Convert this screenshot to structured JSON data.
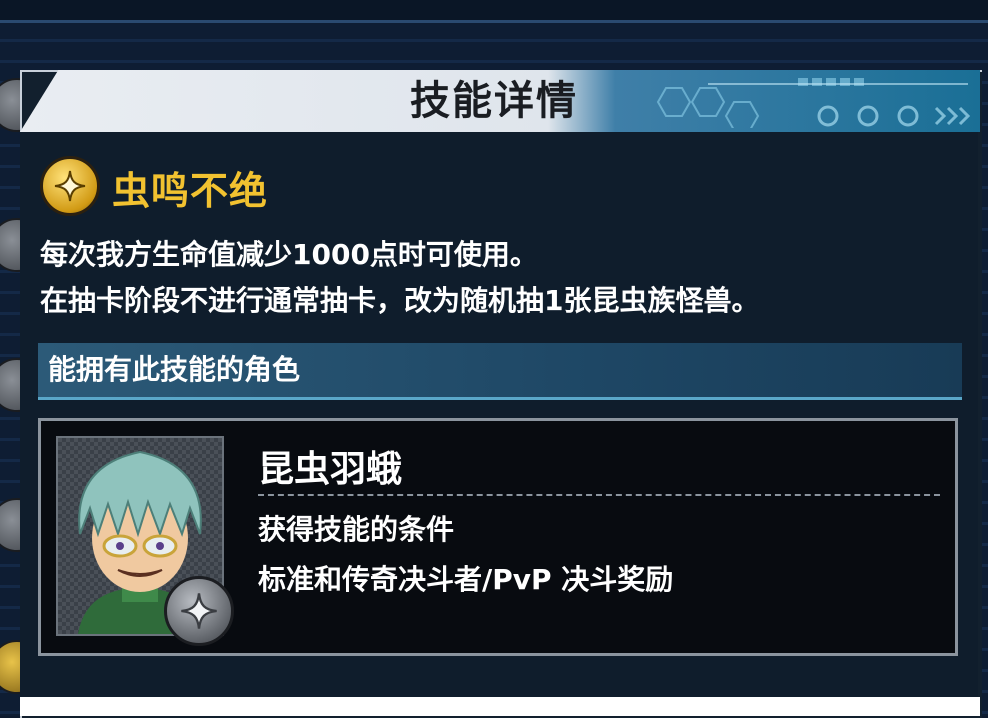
{
  "dialog": {
    "title": "技能详情"
  },
  "skill": {
    "name": "虫鸣不绝",
    "icon": "gold-star-icon",
    "description_lines": [
      "每次我方生命值减少1000点时可使用。",
      "在抽卡阶段不进行通常抽卡，改为随机抽1张昆虫族怪兽。"
    ]
  },
  "section": {
    "title": "能拥有此技能的角色"
  },
  "character": {
    "name": "昆虫羽蛾",
    "condition_label": "获得技能的条件",
    "condition_value": "标准和传奇决斗者/PvP 决斗奖励",
    "badge_icon": "silver-star-icon"
  },
  "colors": {
    "skill_name": "#f2c230",
    "section_bar": "#2c5a78",
    "panel": "#12202e"
  }
}
